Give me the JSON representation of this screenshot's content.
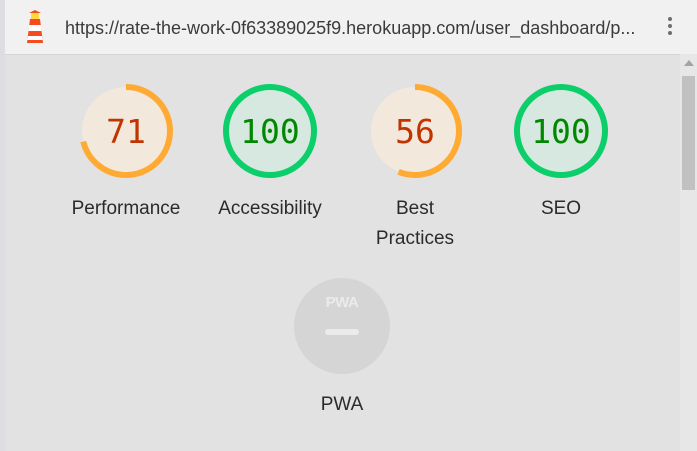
{
  "browser": {
    "url": "https://rate-the-work-0f63389025f9.herokuapp.com/user_dashboard/p...",
    "icon": "lighthouse-icon",
    "menu_icon": "more-vert-icon"
  },
  "scores": [
    {
      "label": "Performance",
      "value": "71",
      "score": 71,
      "color": "#c33300",
      "ring": "#ffaa33",
      "fill": "#f2e9dc"
    },
    {
      "label": "Accessibility",
      "value": "100",
      "score": 100,
      "color": "#008800",
      "ring": "#0cce6b",
      "fill": "#d6e8df"
    },
    {
      "label": "Best Practices",
      "value": "56",
      "score": 56,
      "color": "#c33300",
      "ring": "#ffaa33",
      "fill": "#f2e9dc"
    },
    {
      "label": "SEO",
      "value": "100",
      "score": 100,
      "color": "#008800",
      "ring": "#0cce6b",
      "fill": "#d6e8df"
    }
  ],
  "pwa": {
    "badge_text": "PWA",
    "label": "PWA"
  }
}
